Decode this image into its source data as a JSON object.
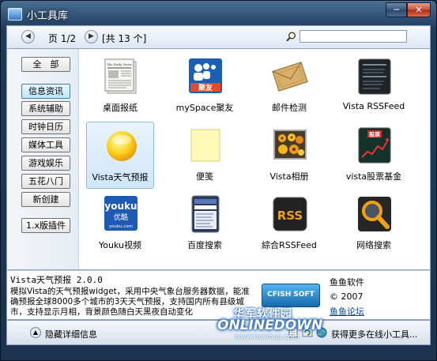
{
  "window": {
    "title": "小工具库"
  },
  "toolbar": {
    "prev_icon": "chevron-left",
    "next_icon": "chevron-right",
    "page_label": "页 1/2",
    "count_label": "[共 13 个]",
    "search_value": "",
    "search_icon": "magnifier"
  },
  "sidebar": {
    "items": [
      {
        "label": "全　部"
      },
      {
        "label": "信息资讯",
        "active": true
      },
      {
        "label": "系统辅助"
      },
      {
        "label": "时钟日历"
      },
      {
        "label": "媒体工具"
      },
      {
        "label": "游戏娱乐"
      },
      {
        "label": "五花八门"
      },
      {
        "label": "新创建"
      },
      {
        "label": "1.x版插件"
      }
    ]
  },
  "gadgets": [
    {
      "label": "桌面报纸",
      "icon": "newspaper-icon",
      "icon_text": "The Daily News"
    },
    {
      "label": "mySpace聚友",
      "icon": "myspace-icon",
      "icon_text": "聚友"
    },
    {
      "label": "邮件检测",
      "icon": "envelope-icon"
    },
    {
      "label": "Vista RSSFeed",
      "icon": "rss-feed-icon"
    },
    {
      "label": "Vista天气预报",
      "icon": "sun-icon",
      "selected": true
    },
    {
      "label": "便笺",
      "icon": "sticky-note-icon"
    },
    {
      "label": "Vista相册",
      "icon": "photo-album-icon"
    },
    {
      "label": "vista股票基金",
      "icon": "stock-chart-icon",
      "icon_text": "股票"
    },
    {
      "label": "Youku视频",
      "icon": "youku-icon",
      "icon_text": "youku",
      "icon_subtext": "优酷",
      "icon_url": "youku.com"
    },
    {
      "label": "百度搜索",
      "icon": "baidu-search-icon"
    },
    {
      "label": "綜合RSSFeed",
      "icon": "rss-icon",
      "icon_text": "RSS"
    },
    {
      "label": "网络搜索",
      "icon": "search-magnifier-icon"
    }
  ],
  "info": {
    "title": "Vista天气预报 2.0.0",
    "description": "模拟Vista的天气预报widget，采用中央气象台服务器数据，能准确预报全球8000多个城市的3天天气预报，支持国内所有县级城市，支持显示月相，背景颜色随白天黑夜自动变化",
    "logo_text": "CFISH SOFT",
    "author": "鱼鱼软件",
    "copyright": "© 2007",
    "forum_link": "鱼鱼论坛"
  },
  "status": {
    "toggle_label": "隐藏详细信息",
    "toggle_icon": "up-arrow",
    "more_label": "获得更多在线小工具..."
  },
  "watermark": {
    "cn": "华军软件园",
    "en": "ONLINEDOWN",
    "url": "www.newhua.com"
  },
  "colors": {
    "accent": "#3c7fb1",
    "selection": "#cfe6fb",
    "frame": "#1f3a5a"
  }
}
